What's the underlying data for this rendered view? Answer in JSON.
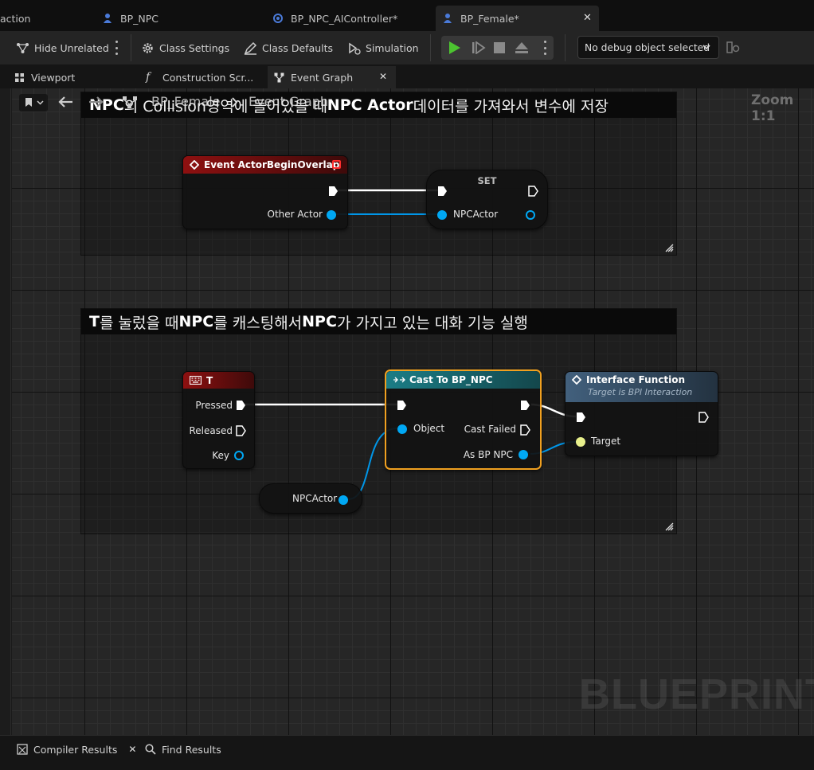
{
  "doc_tabs": [
    {
      "label": "action"
    },
    {
      "label": "BP_NPC"
    },
    {
      "label": "BP_NPC_AIController*"
    },
    {
      "label": "BP_Female*"
    }
  ],
  "toolbar": {
    "hide_unrelated": "Hide Unrelated",
    "class_settings": "Class Settings",
    "class_defaults": "Class Defaults",
    "simulation": "Simulation",
    "debug_object": "No debug object selected"
  },
  "sub_tabs": [
    {
      "label": "Viewport"
    },
    {
      "label": "Construction Scr..."
    },
    {
      "label": "Event Graph"
    }
  ],
  "breadcrumb": {
    "root": "BP_Female",
    "current": "Event Graph"
  },
  "graph": {
    "zoom_label": "Zoom 1:1",
    "watermark": "BLUEPRINT",
    "comments": [
      {
        "prefix": "NPC",
        "mid": "의 Collision ",
        "rest_bold": "",
        "suffix": "영역에 들어있을 때 ",
        "bold2": "NPC Actor",
        "tail": " 데이터를 가져와서 변수에 저장",
        "kind": "collision"
      },
      {
        "bold_t": "T",
        "p1": "를 눌렀을 때 ",
        "bold_npc1": "NPC",
        "p2": "를 캐스팅해서 ",
        "bold_npc2": "NPC",
        "p3": "가 가지고 있는 대화 기능 실행",
        "kind": "keypress"
      }
    ],
    "nodes": {
      "begin_overlap": {
        "title": "Event ActorBeginOverlap",
        "pin_other_actor": "Other Actor"
      },
      "set": {
        "title": "SET",
        "pin_npcactor": "NPCActor"
      },
      "key_t": {
        "title": "T",
        "pin_pressed": "Pressed",
        "pin_released": "Released",
        "pin_key": "Key"
      },
      "cast": {
        "title": "Cast To BP_NPC",
        "pin_object": "Object",
        "pin_cast_failed": "Cast Failed",
        "pin_as_bp_npc": "As BP NPC"
      },
      "interface": {
        "title": "Interface Function",
        "subtitle": "Target is BPI Interaction",
        "pin_target": "Target"
      },
      "get_npcactor": {
        "label": "NPCActor"
      }
    }
  },
  "bottom_tabs": [
    {
      "label": "Compiler Results"
    },
    {
      "label": "Find Results"
    }
  ],
  "colors": {
    "event_red": "#8a1010",
    "cast_teal": "#1f7f86",
    "interface_blue": "#3f5f7f",
    "object_pin": "#00a8f4",
    "selection_orange": "#f0a020",
    "exec_white": "#ffffff",
    "target_yellow": "#e8f08c"
  }
}
